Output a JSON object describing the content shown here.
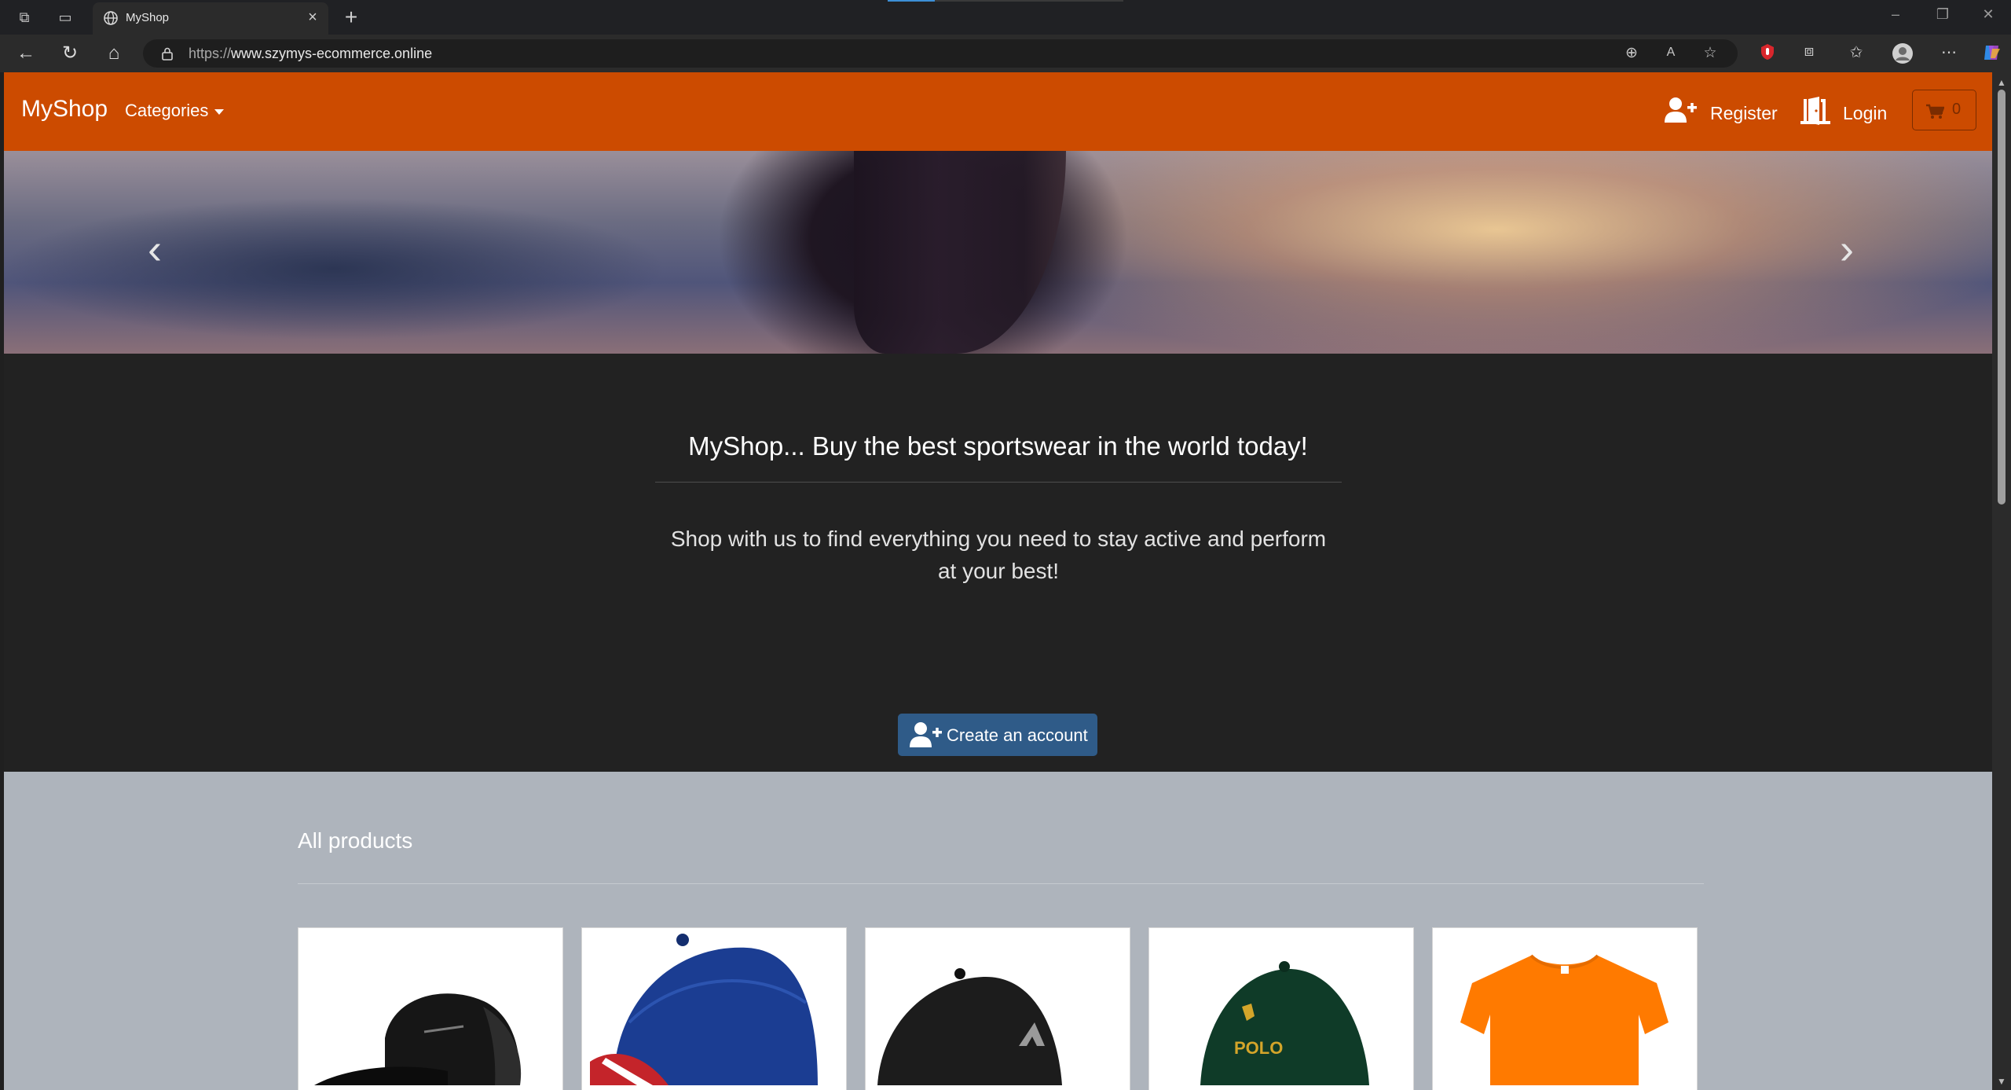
{
  "browser": {
    "tab_title": "MyShop",
    "url_protocol": "https://",
    "url_host": "www.szymys-ecommerce.online"
  },
  "site": {
    "brand": "MyShop",
    "categories_label": "Categories",
    "register_label": "Register",
    "login_label": "Login",
    "cart_count": "0"
  },
  "hero": {
    "heading": "MyShop... Buy the best sportswear in the world today!",
    "subtext": "Shop with us to find everything you need to stay active and perform at your best!",
    "cta_label": "Create an account"
  },
  "products": {
    "heading": "All products",
    "items": [
      {
        "name": "black-trucker-cap",
        "color": "#151515",
        "accent": "#3a3a3a"
      },
      {
        "name": "blue-baseball-cap",
        "color": "#1c3d8f",
        "accent": "#c8242a"
      },
      {
        "name": "black-sport-cap",
        "color": "#1d1d1d",
        "accent": "#9a9a9a"
      },
      {
        "name": "green-polo-cap",
        "color": "#0f3b28",
        "accent": "#d4a52a",
        "logo": "POLO"
      },
      {
        "name": "orange-t-shirt",
        "color": "#ff7a00",
        "accent": "#e56c00"
      }
    ]
  },
  "colors": {
    "navbar": "#cc4b00",
    "hero_bg": "#222222",
    "cta": "#2f5b88",
    "products_bg": "#aeb4bc"
  }
}
